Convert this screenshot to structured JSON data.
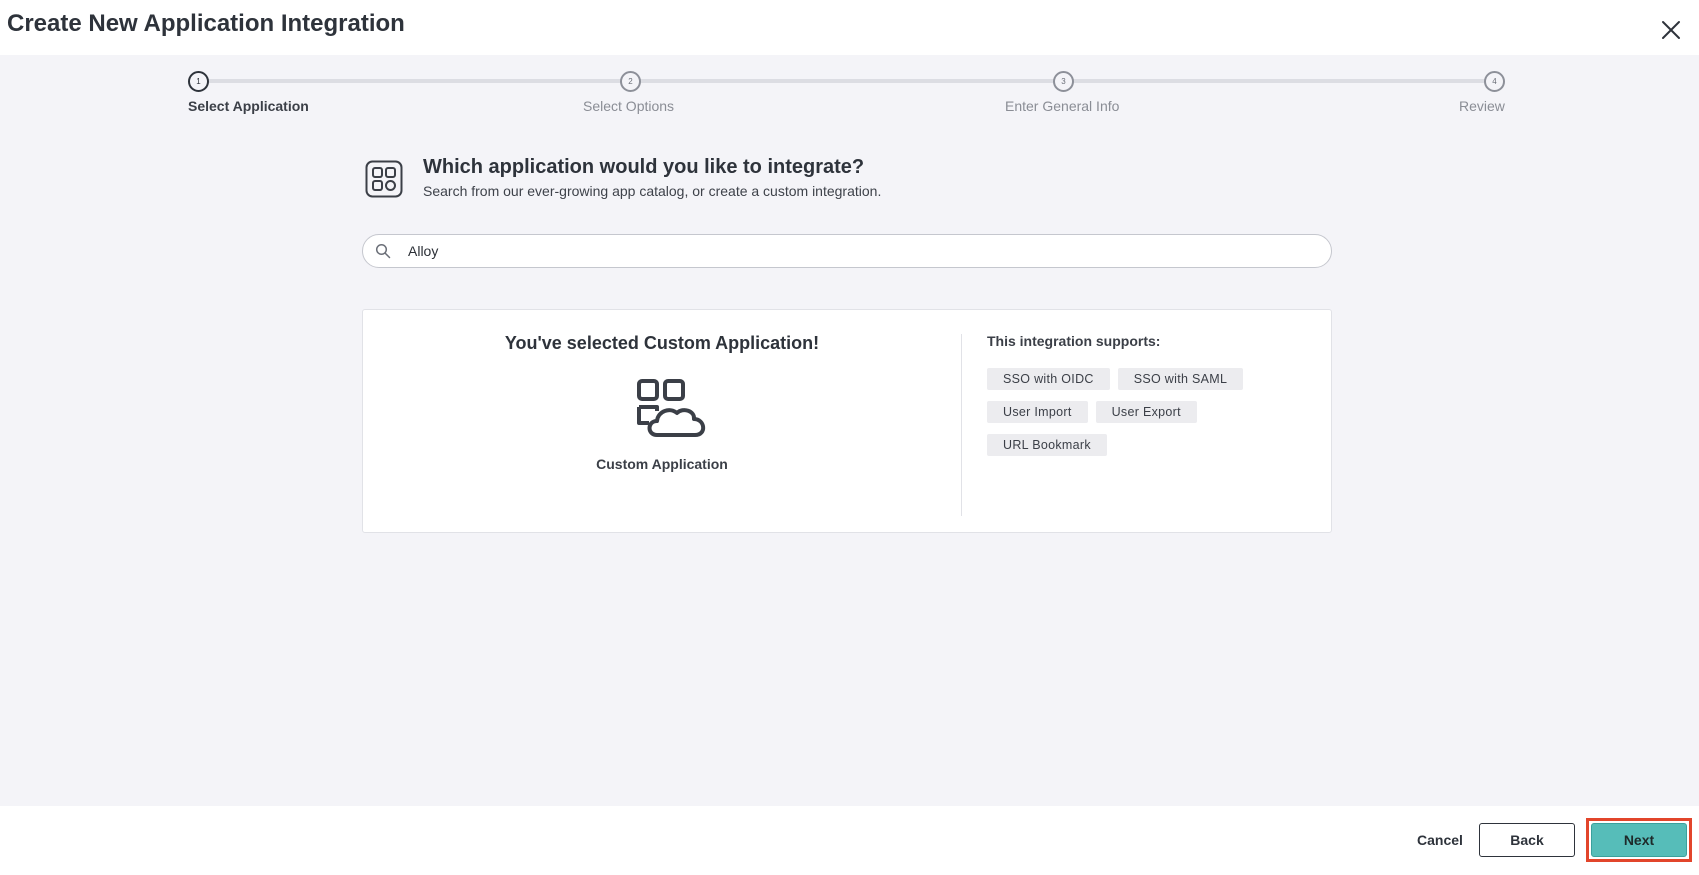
{
  "header": {
    "title": "Create New Application Integration",
    "close_icon": "close-icon"
  },
  "stepper": {
    "steps": [
      {
        "number": "1",
        "label": "Select Application",
        "active": true
      },
      {
        "number": "2",
        "label": "Select Options",
        "active": false
      },
      {
        "number": "3",
        "label": "Enter General Info",
        "active": false
      },
      {
        "number": "4",
        "label": "Review",
        "active": false
      }
    ]
  },
  "question": {
    "icon": "app-catalog-icon",
    "title": "Which application would you like to integrate?",
    "subtitle": "Search from our ever-growing app catalog, or create a custom integration."
  },
  "search": {
    "icon": "search-icon",
    "value": "Alloy"
  },
  "selection": {
    "title": "You've selected Custom Application!",
    "app_icon": "custom-application-icon",
    "app_name": "Custom Application",
    "supports_title": "This integration supports:",
    "tags": [
      "SSO with OIDC",
      "SSO with SAML",
      "User Import",
      "User Export",
      "URL Bookmark"
    ]
  },
  "footer": {
    "cancel_label": "Cancel",
    "back_label": "Back",
    "next_label": "Next"
  },
  "colors": {
    "accent": "#56bdb9",
    "highlight": "#e2452b",
    "body_background": "#f4f4f8",
    "text_dark": "#2e333b"
  }
}
